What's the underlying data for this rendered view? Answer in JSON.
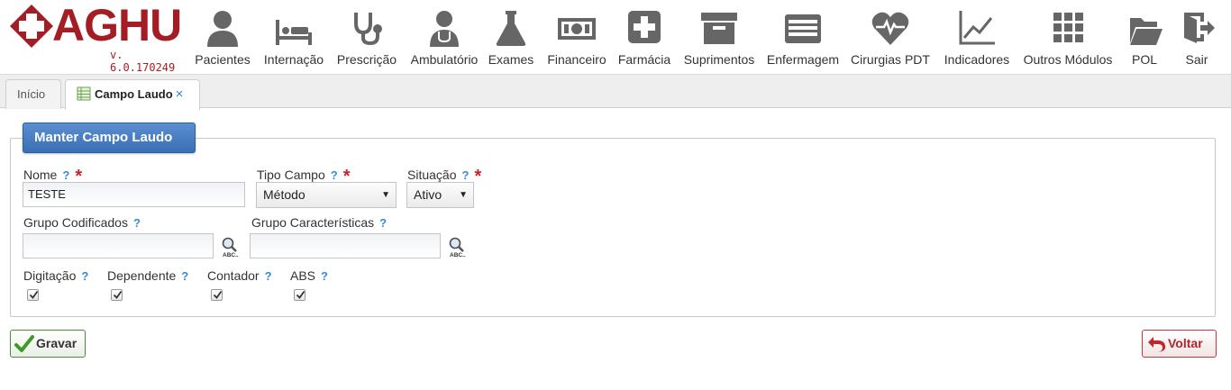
{
  "app": {
    "logo_text": "AGHU",
    "version": "v. 6.0.170249",
    "brand_color": "#a51d24"
  },
  "modules": [
    {
      "label": "Pacientes",
      "icon": "person-icon"
    },
    {
      "label": "Internação",
      "icon": "bed-icon"
    },
    {
      "label": "Prescrição",
      "icon": "stethoscope-icon"
    },
    {
      "label": "Ambulatório",
      "icon": "doctor-icon"
    },
    {
      "label": "Exames",
      "icon": "flask-icon"
    },
    {
      "label": "Financeiro",
      "icon": "money-icon"
    },
    {
      "label": "Farmácia",
      "icon": "pharmacy-cross-icon"
    },
    {
      "label": "Suprimentos",
      "icon": "archive-box-icon"
    },
    {
      "label": "Enfermagem",
      "icon": "list-panel-icon"
    },
    {
      "label": "Cirurgias PDT",
      "icon": "heartbeat-icon"
    },
    {
      "label": "Indicadores",
      "icon": "line-chart-icon"
    },
    {
      "label": "Outros Módulos",
      "icon": "grid-icon"
    },
    {
      "label": "POL",
      "icon": "folder-icon"
    },
    {
      "label": "Sair",
      "icon": "exit-icon"
    }
  ],
  "tabs": [
    {
      "label": "Início"
    },
    {
      "label": "Campo Laudo",
      "close": "×",
      "icon": "table-icon"
    }
  ],
  "form": {
    "legend": "Manter Campo Laudo",
    "help_mark": "?",
    "required_mark": "*",
    "nome": {
      "label": "Nome",
      "value": "TESTE"
    },
    "tipo_campo": {
      "label": "Tipo Campo",
      "value": "Método"
    },
    "situacao": {
      "label": "Situação",
      "value": "Ativo"
    },
    "grupo_codificados": {
      "label": "Grupo Codificados",
      "value": ""
    },
    "grupo_caracteristicas": {
      "label": "Grupo Características",
      "value": ""
    },
    "checkboxes": [
      {
        "label": "Digitação",
        "checked": true
      },
      {
        "label": "Dependente",
        "checked": true
      },
      {
        "label": "Contador",
        "checked": true
      },
      {
        "label": "ABS",
        "checked": true
      }
    ],
    "lookup_icon": "magnifier-abc-icon"
  },
  "actions": {
    "gravar_label": "Gravar",
    "voltar_label": "Voltar",
    "gravar_icon": "checkmark-icon",
    "voltar_icon": "undo-arrow-icon"
  }
}
